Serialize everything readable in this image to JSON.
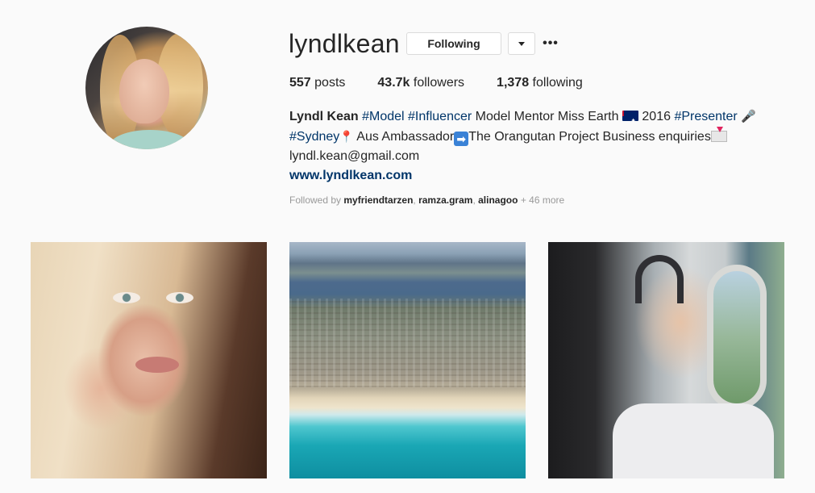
{
  "profile": {
    "username": "lyndlkean",
    "following_label": "Following",
    "more_label": "•••",
    "stats": {
      "posts_count": "557",
      "posts_label": "posts",
      "followers_count": "43.7k",
      "followers_label": "followers",
      "following_count": "1,378",
      "following_label": "following"
    },
    "bio": {
      "name": "Lyndl Kean",
      "tag_model": "#Model",
      "tag_influencer": "#Influencer",
      "text_1": "Model Mentor Miss Earth",
      "text_2": "2016",
      "tag_presenter": "#Presenter",
      "tag_sydney": "#Sydney",
      "text_3": "Aus Ambassador",
      "text_4": "The Orangutan Project Business enquiries",
      "email": "lyndl.kean@gmail.com",
      "website": "www.lyndlkean.com"
    },
    "followed_by": {
      "prefix": "Followed by",
      "user_1": "myfriendtarzen",
      "user_2": "ramza.gram",
      "user_3": "alinagoo",
      "suffix": "+ 46 more"
    }
  },
  "icons": {
    "flag": "australia-flag-icon",
    "microphone": "microphone-icon",
    "pin": "round-pushpin-icon",
    "arrow": "right-arrow-icon",
    "envelope": "envelope-with-arrow-icon",
    "dropdown": "chevron-down-icon"
  },
  "colors": {
    "background": "#fafafa",
    "text": "#262626",
    "link": "#003569",
    "muted": "#999999",
    "border": "#dbdbdb"
  }
}
